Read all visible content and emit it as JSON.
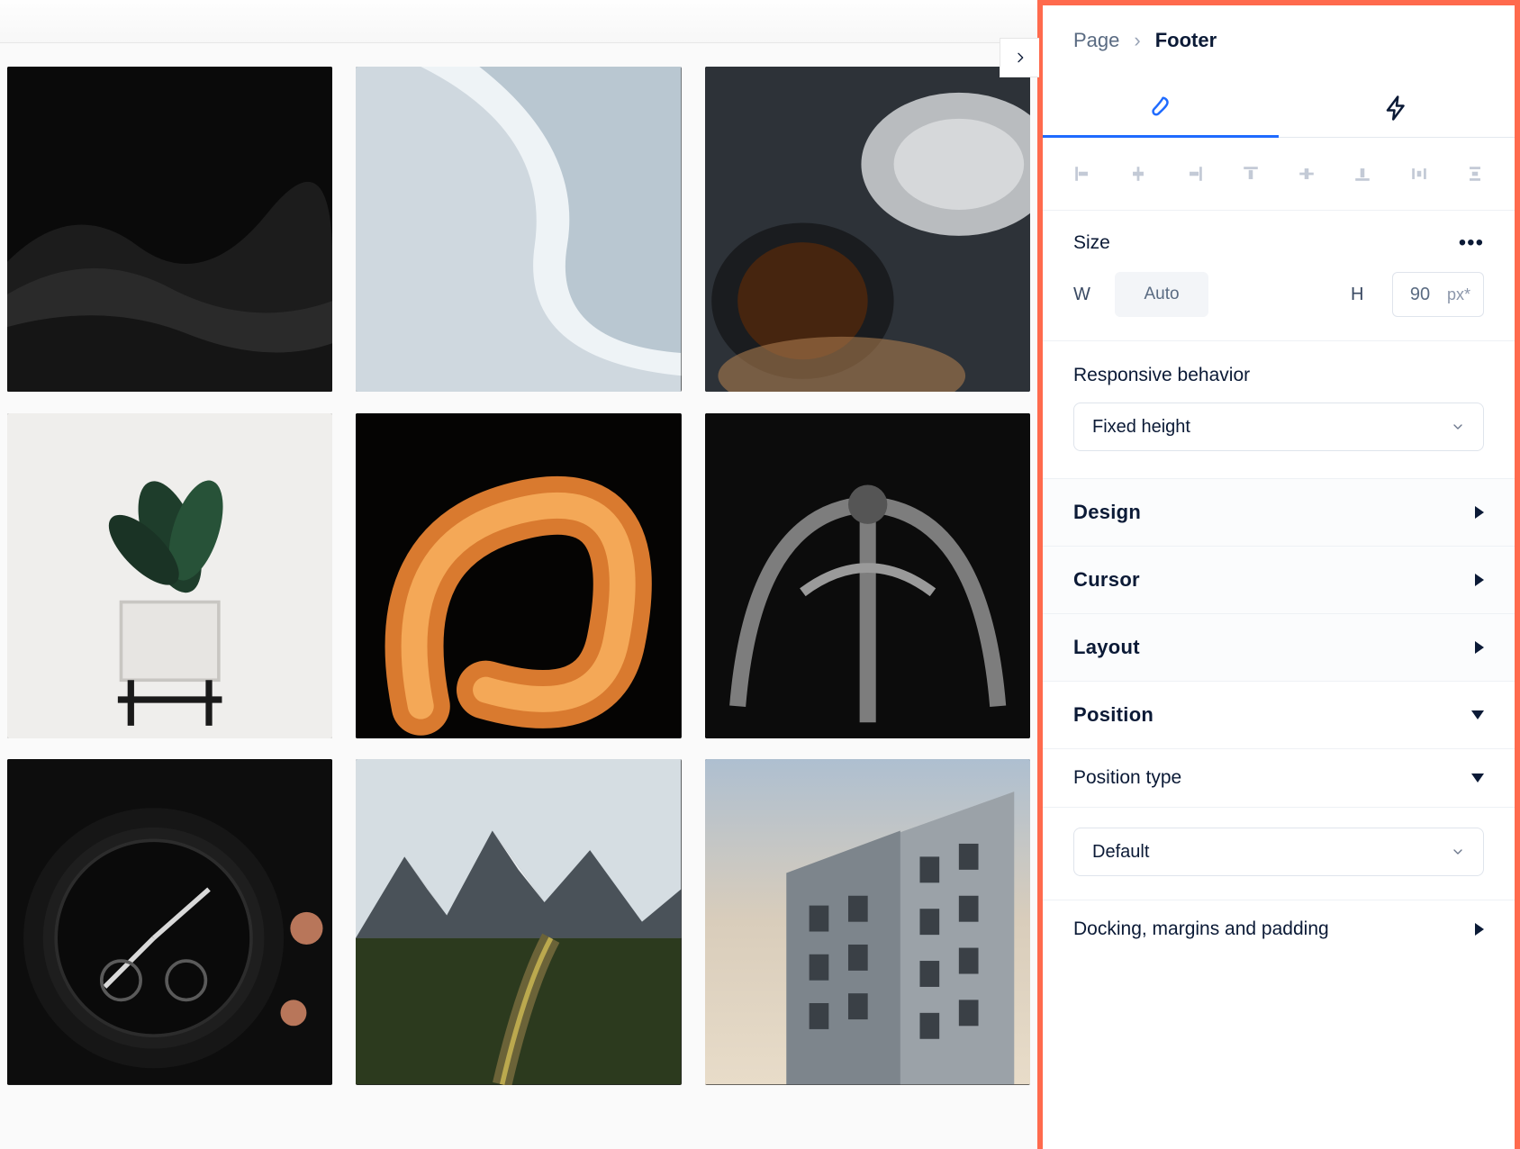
{
  "breadcrumb": {
    "page": "Page",
    "current": "Footer"
  },
  "panel": {
    "size": {
      "title": "Size",
      "w_label": "W",
      "w_value": "Auto",
      "h_label": "H",
      "h_value": "90",
      "h_unit": "px*"
    },
    "responsive": {
      "label": "Responsive behavior",
      "value": "Fixed height"
    },
    "accordion": {
      "design": "Design",
      "cursor": "Cursor",
      "layout": "Layout",
      "position": "Position",
      "position_type": "Position type",
      "position_type_value": "Default",
      "docking": "Docking, margins and padding"
    }
  }
}
